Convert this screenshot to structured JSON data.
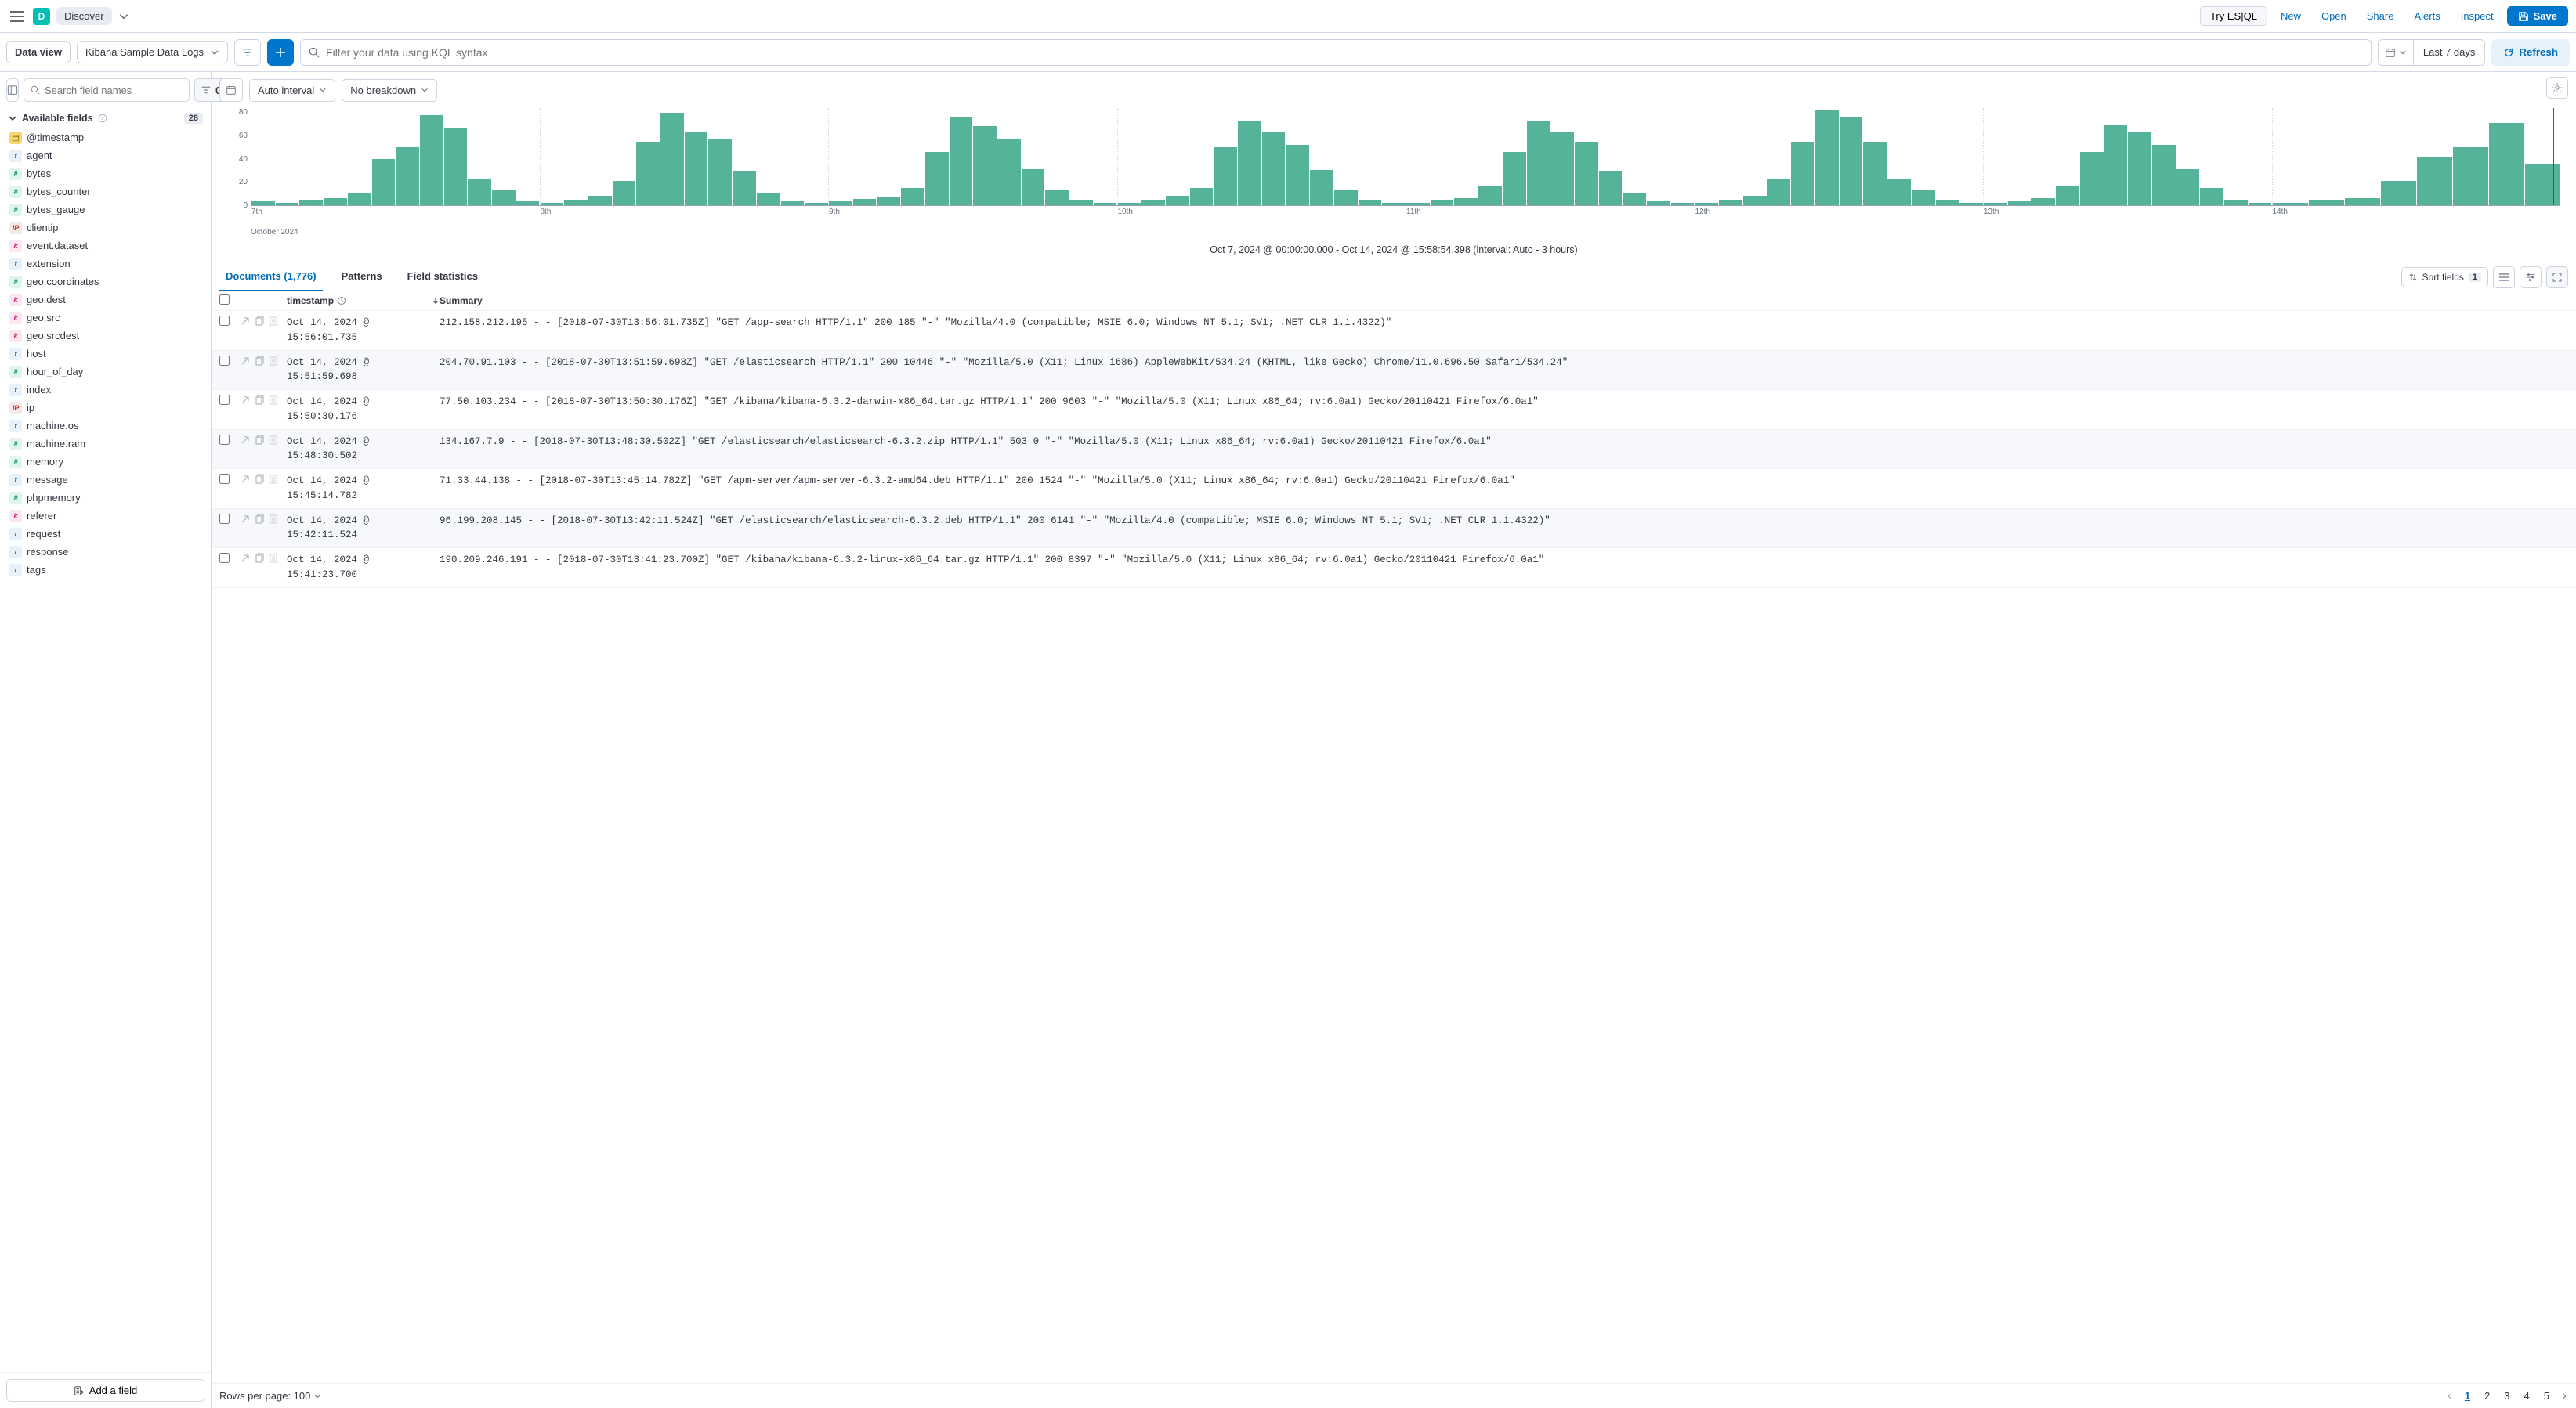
{
  "header": {
    "app_letter": "D",
    "app_name": "Discover",
    "try_esql": "Try ES|QL",
    "nav": {
      "new": "New",
      "open": "Open",
      "share": "Share",
      "alerts": "Alerts",
      "inspect": "Inspect"
    },
    "save": "Save"
  },
  "filterbar": {
    "dataview_label": "Data view",
    "dataview_value": "Kibana Sample Data Logs",
    "search_placeholder": "Filter your data using KQL syntax",
    "datepicker": "Last 7 days",
    "refresh": "Refresh"
  },
  "sidebar": {
    "search_placeholder": "Search field names",
    "filter_count": "0",
    "available_label": "Available fields",
    "available_count": "28",
    "fields": [
      {
        "type": "date",
        "name": "@timestamp"
      },
      {
        "type": "t",
        "name": "agent"
      },
      {
        "type": "num",
        "name": "bytes"
      },
      {
        "type": "num",
        "name": "bytes_counter"
      },
      {
        "type": "num",
        "name": "bytes_gauge"
      },
      {
        "type": "ip",
        "name": "clientip"
      },
      {
        "type": "k",
        "name": "event.dataset"
      },
      {
        "type": "t",
        "name": "extension"
      },
      {
        "type": "num",
        "name": "geo.coordinates"
      },
      {
        "type": "k",
        "name": "geo.dest"
      },
      {
        "type": "k",
        "name": "geo.src"
      },
      {
        "type": "k",
        "name": "geo.srcdest"
      },
      {
        "type": "t",
        "name": "host"
      },
      {
        "type": "num",
        "name": "hour_of_day"
      },
      {
        "type": "t",
        "name": "index"
      },
      {
        "type": "ip",
        "name": "ip"
      },
      {
        "type": "t",
        "name": "machine.os"
      },
      {
        "type": "num",
        "name": "machine.ram"
      },
      {
        "type": "num",
        "name": "memory"
      },
      {
        "type": "t",
        "name": "message"
      },
      {
        "type": "num",
        "name": "phpmemory"
      },
      {
        "type": "k",
        "name": "referer"
      },
      {
        "type": "t",
        "name": "request"
      },
      {
        "type": "t",
        "name": "response"
      },
      {
        "type": "t",
        "name": "tags"
      }
    ],
    "add_field": "Add a field"
  },
  "chart_controls": {
    "interval": "Auto interval",
    "breakdown": "No breakdown"
  },
  "chart_data": {
    "type": "bar",
    "ylabel": "",
    "ylim": [
      0,
      80
    ],
    "yticks": [
      0,
      20,
      40,
      60,
      80
    ],
    "x_month": "October 2024",
    "days": [
      {
        "label": "7th",
        "bars": [
          3,
          2,
          4,
          6,
          10,
          38,
          48,
          74,
          63,
          22,
          12,
          3
        ]
      },
      {
        "label": "8th",
        "bars": [
          2,
          4,
          8,
          20,
          52,
          76,
          60,
          54,
          28,
          10,
          3,
          2
        ]
      },
      {
        "label": "9th",
        "bars": [
          3,
          5,
          7,
          14,
          44,
          72,
          65,
          54,
          30,
          12,
          4,
          2
        ]
      },
      {
        "label": "10th",
        "bars": [
          2,
          4,
          8,
          14,
          48,
          70,
          60,
          50,
          29,
          12,
          4,
          2
        ]
      },
      {
        "label": "11th",
        "bars": [
          2,
          4,
          6,
          16,
          44,
          70,
          60,
          52,
          28,
          10,
          3,
          2
        ]
      },
      {
        "label": "12th",
        "bars": [
          2,
          4,
          8,
          22,
          52,
          78,
          72,
          52,
          22,
          12,
          4,
          2
        ]
      },
      {
        "label": "13th",
        "bars": [
          2,
          3,
          6,
          16,
          44,
          66,
          60,
          50,
          30,
          14,
          4,
          2
        ]
      },
      {
        "label": "14th",
        "bars": [
          2,
          4,
          6,
          20,
          40,
          48,
          68,
          34
        ]
      }
    ]
  },
  "chart_caption": "Oct 7, 2024 @ 00:00:00.000 - Oct 14, 2024 @ 15:58:54.398 (interval: Auto - 3 hours)",
  "tabs": {
    "documents": "Documents (1,776)",
    "patterns": "Patterns",
    "field_stats": "Field statistics",
    "sort_fields": "Sort fields",
    "sort_count": "1"
  },
  "table": {
    "col_timestamp": "timestamp",
    "col_summary": "Summary",
    "rows": [
      {
        "ts": "Oct 14, 2024 @ 15:56:01.735",
        "sum": "212.158.212.195 - - [2018-07-30T13:56:01.735Z] \"GET /app-search HTTP/1.1\" 200 185 \"-\" \"Mozilla/4.0 (compatible; MSIE 6.0; Windows NT 5.1; SV1; .NET CLR 1.1.4322)\""
      },
      {
        "ts": "Oct 14, 2024 @ 15:51:59.698",
        "sum": "204.70.91.103 - - [2018-07-30T13:51:59.698Z] \"GET /elasticsearch HTTP/1.1\" 200 10446 \"-\" \"Mozilla/5.0 (X11; Linux i686) AppleWebKit/534.24 (KHTML, like Gecko) Chrome/11.0.696.50 Safari/534.24\""
      },
      {
        "ts": "Oct 14, 2024 @ 15:50:30.176",
        "sum": "77.50.103.234 - - [2018-07-30T13:50:30.176Z] \"GET /kibana/kibana-6.3.2-darwin-x86_64.tar.gz HTTP/1.1\" 200 9603 \"-\" \"Mozilla/5.0 (X11; Linux x86_64; rv:6.0a1) Gecko/20110421 Firefox/6.0a1\""
      },
      {
        "ts": "Oct 14, 2024 @ 15:48:30.502",
        "sum": "134.167.7.9 - - [2018-07-30T13:48:30.502Z] \"GET /elasticsearch/elasticsearch-6.3.2.zip HTTP/1.1\" 503 0 \"-\" \"Mozilla/5.0 (X11; Linux x86_64; rv:6.0a1) Gecko/20110421 Firefox/6.0a1\""
      },
      {
        "ts": "Oct 14, 2024 @ 15:45:14.782",
        "sum": "71.33.44.138 - - [2018-07-30T13:45:14.782Z] \"GET /apm-server/apm-server-6.3.2-amd64.deb HTTP/1.1\" 200 1524 \"-\" \"Mozilla/5.0 (X11; Linux x86_64; rv:6.0a1) Gecko/20110421 Firefox/6.0a1\""
      },
      {
        "ts": "Oct 14, 2024 @ 15:42:11.524",
        "sum": "96.199.208.145 - - [2018-07-30T13:42:11.524Z] \"GET /elasticsearch/elasticsearch-6.3.2.deb HTTP/1.1\" 200 6141 \"-\" \"Mozilla/4.0 (compatible; MSIE 6.0; Windows NT 5.1; SV1; .NET CLR 1.1.4322)\""
      },
      {
        "ts": "Oct 14, 2024 @ 15:41:23.700",
        "sum": "190.209.246.191 - - [2018-07-30T13:41:23.700Z] \"GET /kibana/kibana-6.3.2-linux-x86_64.tar.gz HTTP/1.1\" 200 8397 \"-\" \"Mozilla/5.0 (X11; Linux x86_64; rv:6.0a1) Gecko/20110421 Firefox/6.0a1\""
      }
    ]
  },
  "footer": {
    "rows_per_page": "Rows per page: 100",
    "pages": [
      "1",
      "2",
      "3",
      "4",
      "5"
    ]
  }
}
